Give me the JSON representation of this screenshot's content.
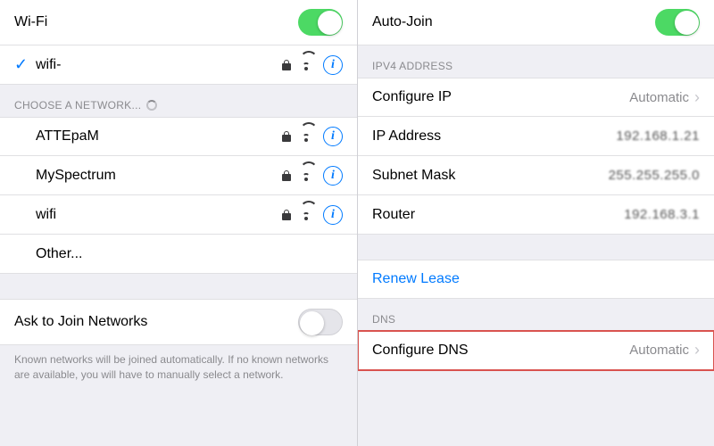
{
  "left": {
    "wifi_label": "Wi-Fi",
    "connected_network": "wifi-",
    "choose_header": "CHOOSE A NETWORK...",
    "networks": [
      "ATTEpaM",
      "MySpectrum",
      "wifi"
    ],
    "other_label": "Other...",
    "ask_join_label": "Ask to Join Networks",
    "footer": "Known networks will be joined automatically. If no known networks are available, you will have to manually select a network."
  },
  "right": {
    "auto_join_label": "Auto-Join",
    "ipv4_header": "IPV4 ADDRESS",
    "configure_ip_label": "Configure IP",
    "configure_ip_value": "Automatic",
    "ip_address_label": "IP Address",
    "ip_address_value": "192.168.1.21",
    "subnet_label": "Subnet Mask",
    "subnet_value": "255.255.255.0",
    "router_label": "Router",
    "router_value": "192.168.3.1",
    "renew_lease": "Renew Lease",
    "dns_header": "DNS",
    "configure_dns_label": "Configure DNS",
    "configure_dns_value": "Automatic"
  }
}
